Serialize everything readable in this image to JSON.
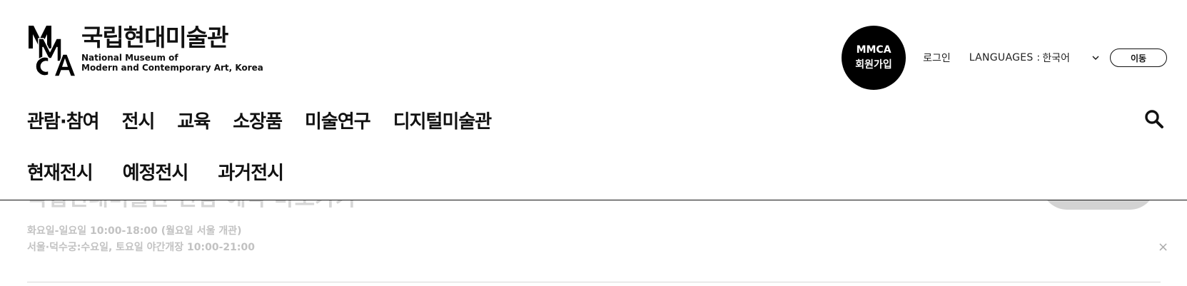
{
  "logo": {
    "name_kr": "국립현대미술관",
    "name_en_line1": "National Museum of",
    "name_en_line2": "Modern and Contemporary Art, Korea"
  },
  "utility": {
    "join_line1": "MMCA",
    "join_line2": "회원가입",
    "login": "로그인",
    "languages_label": "LANGUAGES :",
    "language_selected": "한국어",
    "go_button": "이동"
  },
  "gnb": {
    "items": [
      {
        "label": "관람·참여"
      },
      {
        "label": "전시"
      },
      {
        "label": "교육"
      },
      {
        "label": "소장품"
      },
      {
        "label": "미술연구"
      },
      {
        "label": "디지털미술관"
      }
    ]
  },
  "sub_nav": {
    "items": [
      {
        "label": "현재전시"
      },
      {
        "label": "예정전시"
      },
      {
        "label": "과거전시"
      }
    ]
  },
  "notice": {
    "title_partial": "국립현대미술관 관람 예약 바로가기",
    "line1": "화요일-일요일 10:00-18:00 (월요일 서울 개관)",
    "line2": "서울·덕수궁:수요일, 토요일 야간개장 10:00-21:00",
    "close": "×"
  },
  "icons": {
    "search": "search-icon",
    "chevron": "chevron-down-icon",
    "logo": "mmca-logo-icon"
  },
  "colors": {
    "text": "#111111",
    "join_bg": "#000000",
    "notice_text": "#c2c2c2"
  }
}
